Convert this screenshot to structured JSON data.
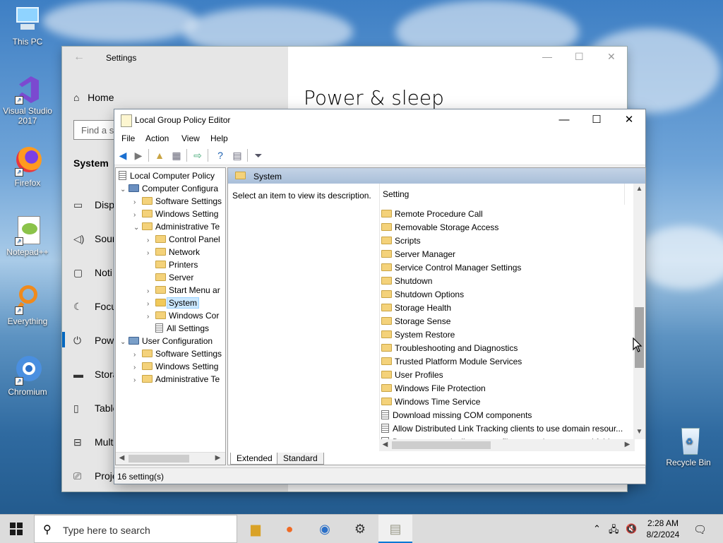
{
  "desktop": {
    "icons": [
      {
        "label": "This PC"
      },
      {
        "label": "Visual Studio 2017"
      },
      {
        "label": "Firefox"
      },
      {
        "label": "Notepad++"
      },
      {
        "label": "Everything"
      },
      {
        "label": "Chromium"
      },
      {
        "label": "Recycle Bin"
      }
    ]
  },
  "settings": {
    "title": "Settings",
    "home": "Home",
    "find_placeholder": "Find a s",
    "section": "System",
    "nav": [
      "Disp",
      "Sour",
      "Noti",
      "Focu",
      "Powe",
      "Stora",
      "Table",
      "Mult",
      "Proje"
    ],
    "heading": "Power & sleep"
  },
  "gpe": {
    "title": "Local Group Policy Editor",
    "menu": [
      "File",
      "Action",
      "View",
      "Help"
    ],
    "tree": [
      {
        "label": "Local Computer Policy"
      },
      {
        "label": "Computer Configura"
      },
      {
        "label": "Software Settings"
      },
      {
        "label": "Windows Setting"
      },
      {
        "label": "Administrative Te"
      },
      {
        "label": "Control Panel"
      },
      {
        "label": "Network"
      },
      {
        "label": "Printers"
      },
      {
        "label": "Server"
      },
      {
        "label": "Start Menu ar"
      },
      {
        "label": "System"
      },
      {
        "label": "Windows Cor"
      },
      {
        "label": "All Settings"
      },
      {
        "label": "User Configuration"
      },
      {
        "label": "Software Settings"
      },
      {
        "label": "Windows Setting"
      },
      {
        "label": "Administrative Te"
      }
    ],
    "header_folder": "System",
    "description": "Select an item to view its description.",
    "column_setting": "Setting",
    "items": [
      {
        "label": "Remote Procedure Call",
        "kind": "folder"
      },
      {
        "label": "Removable Storage Access",
        "kind": "folder"
      },
      {
        "label": "Scripts",
        "kind": "folder"
      },
      {
        "label": "Server Manager",
        "kind": "folder"
      },
      {
        "label": "Service Control Manager Settings",
        "kind": "folder"
      },
      {
        "label": "Shutdown",
        "kind": "folder"
      },
      {
        "label": "Shutdown Options",
        "kind": "folder"
      },
      {
        "label": "Storage Health",
        "kind": "folder"
      },
      {
        "label": "Storage Sense",
        "kind": "folder"
      },
      {
        "label": "System Restore",
        "kind": "folder"
      },
      {
        "label": "Troubleshooting and Diagnostics",
        "kind": "folder"
      },
      {
        "label": "Trusted Platform Module Services",
        "kind": "folder"
      },
      {
        "label": "User Profiles",
        "kind": "folder"
      },
      {
        "label": "Windows File Protection",
        "kind": "folder"
      },
      {
        "label": "Windows Time Service",
        "kind": "folder"
      },
      {
        "label": "Download missing COM components",
        "kind": "policy"
      },
      {
        "label": "Allow Distributed Link Tracking clients to use domain resour...",
        "kind": "policy"
      },
      {
        "label": "Do not automatically encrypt files moved to encrypted fold...",
        "kind": "policy"
      }
    ],
    "tabs": [
      "Extended",
      "Standard"
    ],
    "status": "16 setting(s)"
  },
  "taskbar": {
    "search_placeholder": "Type here to search",
    "time": "2:28 AM",
    "date": "8/2/2024"
  },
  "colors": {
    "selection": "#cce8ff",
    "accent": "#0078d4",
    "folder": "#f4d27a"
  }
}
